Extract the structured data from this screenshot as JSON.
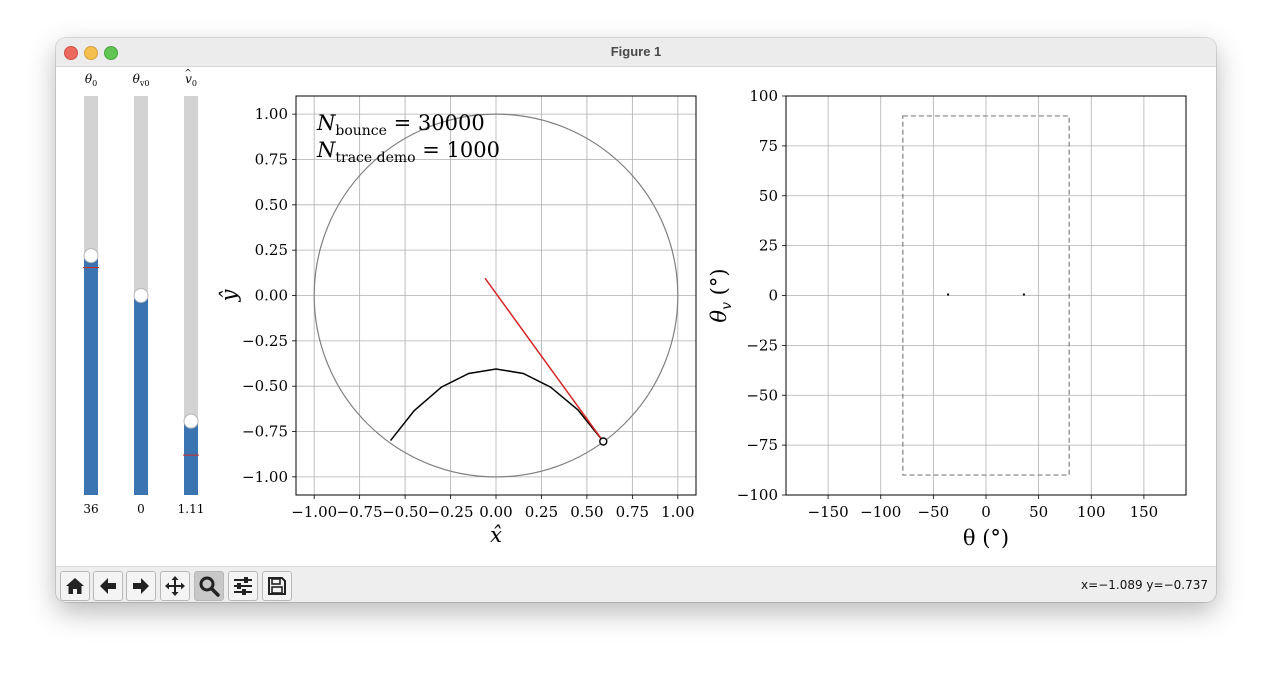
{
  "window": {
    "title": "Figure 1"
  },
  "sliders": [
    {
      "label": "θ",
      "sub": "0",
      "hat": false,
      "value_text": "36",
      "fraction": 0.6,
      "marker_fraction": 0.57
    },
    {
      "label": "θ",
      "sub": "v0",
      "hat": false,
      "value_text": "0",
      "fraction": 0.5,
      "marker_fraction": null
    },
    {
      "label": "v",
      "sub": "0",
      "hat": true,
      "value_text": "1.11",
      "fraction": 0.185,
      "marker_fraction": 0.1
    }
  ],
  "billiard_plot": {
    "xlabel": "x̂",
    "ylabel": "ŷ",
    "xticks": [
      "−1.00",
      "−0.75",
      "−0.50",
      "−0.25",
      "0.00",
      "0.25",
      "0.50",
      "0.75",
      "1.00"
    ],
    "yticks": [
      "−1.00",
      "−0.75",
      "−0.50",
      "−0.25",
      "0.00",
      "0.25",
      "0.50",
      "0.75",
      "1.00"
    ],
    "xlim": [
      -1.1,
      1.1
    ],
    "ylim": [
      -1.1,
      1.1
    ],
    "annotation_lines": [
      {
        "symbol": "N",
        "sub": "bounce",
        "value": " = 30000"
      },
      {
        "symbol": "N",
        "sub": "trace demo",
        "value": " = 1000"
      }
    ],
    "boundary": {
      "type": "circle",
      "radius": 1.0
    },
    "trajectory": [
      [
        -0.58,
        -0.8
      ],
      [
        -0.45,
        -0.635
      ],
      [
        -0.3,
        -0.505
      ],
      [
        -0.15,
        -0.43
      ],
      [
        0.0,
        -0.405
      ],
      [
        0.15,
        -0.43
      ],
      [
        0.3,
        -0.505
      ],
      [
        0.45,
        -0.63
      ],
      [
        0.59,
        -0.805
      ]
    ],
    "velocity_line": [
      [
        -0.06,
        0.095
      ],
      [
        0.59,
        -0.805
      ]
    ],
    "ball": [
      0.59,
      -0.805
    ],
    "colors": {
      "trajectory": "#000000",
      "velocity": "#d62728",
      "boundary": "#808080"
    }
  },
  "phase_plot": {
    "xlabel": "θ (°)",
    "ylabel": "θ_v (°)",
    "xticks": [
      "−150",
      "−100",
      "−50",
      "0",
      "50",
      "100",
      "150"
    ],
    "yticks": [
      "−100",
      "−75",
      "−50",
      "−25",
      "0",
      "25",
      "50",
      "75",
      "100"
    ],
    "xlim": [
      -190,
      190
    ],
    "ylim": [
      -100,
      100
    ],
    "region_box": {
      "x0": -79,
      "x1": 79,
      "y0": -90,
      "y1": 90
    },
    "points": [
      [
        -36,
        0.5
      ],
      [
        36,
        0.5
      ]
    ]
  },
  "toolbar": {
    "buttons": [
      "home-icon",
      "back-arrow-icon",
      "forward-arrow-icon",
      "pan-icon",
      "zoom-icon",
      "configure-subplots-icon",
      "save-icon"
    ],
    "active_button": "zoom-icon",
    "status_text": "x=−1.089 y=−0.737"
  },
  "colors": {
    "slider_fill": "#3b75b1",
    "slider_track": "#d3d3d3",
    "grid": "#b0b0b0"
  }
}
